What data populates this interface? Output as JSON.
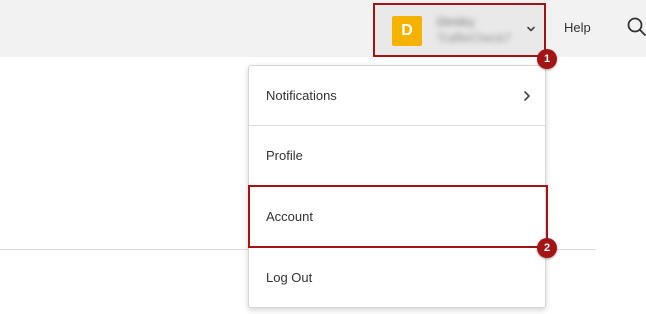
{
  "topbar": {
    "user": {
      "avatar_initial": "D",
      "avatar_color": "#f5b300",
      "name": "Dimitry",
      "org": "TraffieCheck7"
    },
    "help_label": "Help",
    "search_icon": "search-icon"
  },
  "dropdown": {
    "items": [
      {
        "label": "Notifications",
        "icon": "chevron-right-icon"
      },
      {
        "label": "Profile"
      },
      {
        "label": "Account"
      },
      {
        "label": "Log Out"
      }
    ]
  },
  "annotations": {
    "badge_1": "1",
    "badge_2": "2",
    "highlight_color": "#a31515"
  }
}
